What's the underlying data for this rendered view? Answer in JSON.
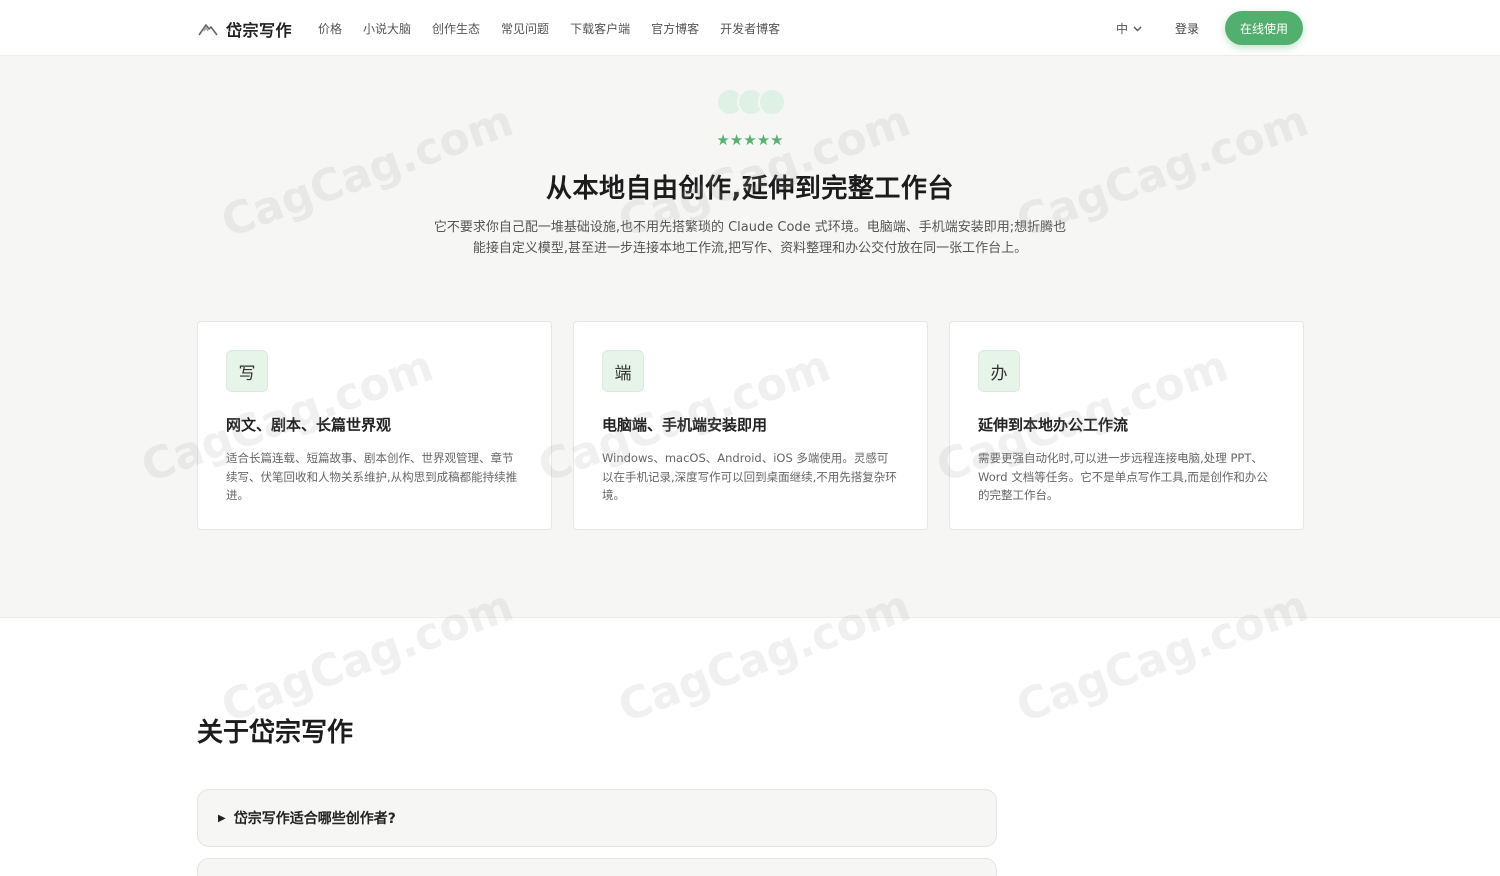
{
  "header": {
    "brand": "岱宗写作",
    "nav": [
      "价格",
      "小说大脑",
      "创作生态",
      "常见问题",
      "下载客户端",
      "官方博客",
      "开发者博客"
    ],
    "lang": "中",
    "login": "登录",
    "cta": "在线使用"
  },
  "hero": {
    "stars": "★★★★★",
    "title": "从本地自由创作,延伸到完整工作台",
    "description": "它不要求你自己配一堆基础设施,也不用先搭繁琐的 Claude Code 式环境。电脑端、手机端安装即用;想折腾也能接自定义模型,甚至进一步连接本地工作流,把写作、资料整理和办公交付放在同一张工作台上。"
  },
  "features": [
    {
      "badge": "写",
      "title": "网文、剧本、长篇世界观",
      "text": "适合长篇连载、短篇故事、剧本创作、世界观管理、章节续写、伏笔回收和人物关系维护,从构思到成稿都能持续推进。"
    },
    {
      "badge": "端",
      "title": "电脑端、手机端安装即用",
      "text": "Windows、macOS、Android、iOS 多端使用。灵感可以在手机记录,深度写作可以回到桌面继续,不用先搭复杂环境。"
    },
    {
      "badge": "办",
      "title": "延伸到本地办公工作流",
      "text": "需要更强自动化时,可以进一步远程连接电脑,处理 PPT、Word 文档等任务。它不是单点写作工具,而是创作和办公的完整工作台。"
    }
  ],
  "about": {
    "title": "关于岱宗写作",
    "faqs": [
      "岱宗写作适合哪些创作者?",
      ""
    ]
  },
  "watermark": "CagCag.com",
  "colors": {
    "accent": "#52b06e",
    "badge_bg": "#e7f4ea",
    "page_bg": "#f6f6f5"
  }
}
